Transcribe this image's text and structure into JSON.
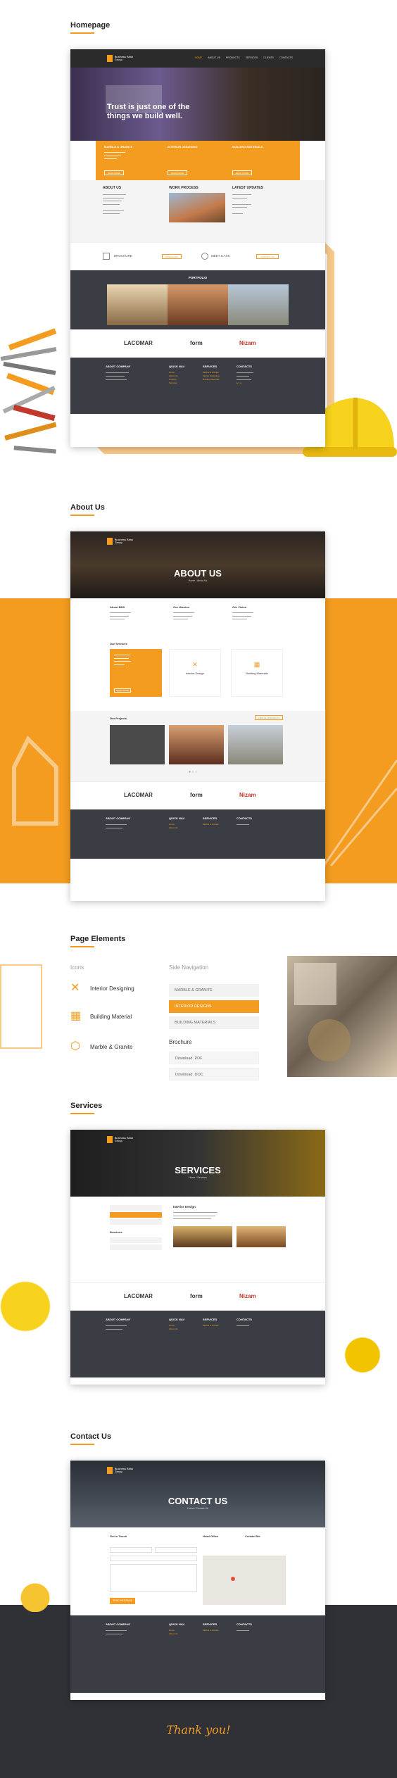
{
  "sections": {
    "homepage": "Homepage",
    "about": "About Us",
    "page_elements": "Page Elements",
    "services": "Services",
    "contact": "Contact Us"
  },
  "colors": {
    "accent": "#f39c1f",
    "dark": "#3a3d43",
    "header": "#2b2b2b"
  },
  "nav": [
    "Home",
    "About Us",
    "Products",
    "Services",
    "Clients",
    "Contacts"
  ],
  "logo_text": "Business Bbsb Group",
  "home": {
    "hero_title_1": "Trust is just one of the",
    "hero_title_2": "things we build well.",
    "features": [
      {
        "title": "MARBLE & GRANITE",
        "btn": "READ MORE"
      },
      {
        "title": "INTERIOR DESIGNING",
        "btn": "READ MORE"
      },
      {
        "title": "BUILDING MATERIALS",
        "btn": "READ MORE"
      }
    ],
    "about_title": "ABOUT US",
    "work_title": "WORK PROCESS",
    "updates_title": "LATEST UPDATES",
    "brochure": "BROCHURE",
    "download": "DOWNLOAD",
    "meet": "MEET & ASK",
    "contact_btn": "CONTACT US",
    "portfolio": "PORTFOLIO"
  },
  "partners": [
    "LACOMAR",
    "form",
    "Nizam"
  ],
  "footer": {
    "col1": "ABOUT COMPANY",
    "col2": "QUICK NAV",
    "col3": "SERVICES",
    "col4": "CONTACTS",
    "links": [
      "Home",
      "About Us",
      "Projects",
      "Services",
      "Contacts"
    ],
    "services": [
      "Marble & Granite",
      "Interior Designing",
      "Building Materials"
    ]
  },
  "about": {
    "hero_title": "ABOUT US",
    "crumb": "Home / About Us",
    "cols": [
      "About BBS",
      "Our Mission",
      "Our Vision"
    ],
    "services_title": "Our Services",
    "services": [
      "Interior Design",
      "Building Materials"
    ],
    "services_btn": "READ MORE",
    "projects_title": "Our Projects",
    "projects_btn": "VIEW ALL PROJECTS"
  },
  "elements": {
    "icons_title": "Icons",
    "icons": [
      "Interior Designing",
      "Building Material",
      "Marble & Granite"
    ],
    "side_title": "Side Navigation",
    "side": [
      "MARBLE & GRANITE",
      "INTERIOR DESIGNS",
      "BUILDING MATERIALS"
    ],
    "brochure_title": "Brochure",
    "brochure": [
      "Download .PDF",
      "Download .DOC"
    ]
  },
  "services": {
    "hero_title": "SERVICES",
    "crumb": "Home / Services",
    "heading": "Interior Design",
    "brochure": "Brochure"
  },
  "contact": {
    "hero_title": "CONTACT US",
    "crumb": "Home / Contact Us",
    "get_in_touch": "Get in Touch",
    "head_office": "Head Office",
    "contact": "Contact Me",
    "send_btn": "SEND MESSAGE"
  },
  "thanks": "Thank you!"
}
